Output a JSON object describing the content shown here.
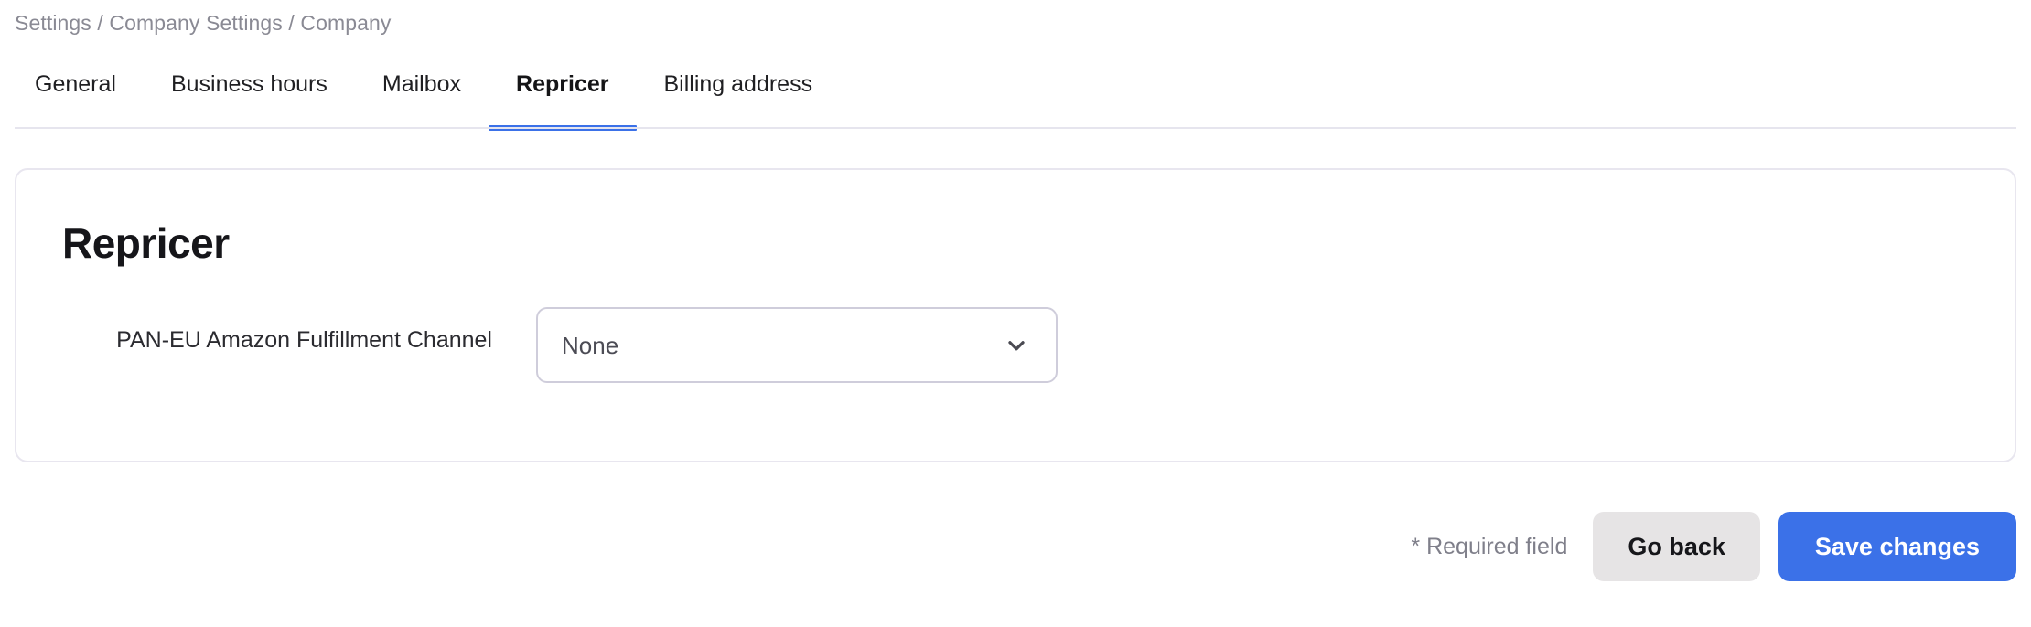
{
  "breadcrumb": {
    "text": "Settings / Company Settings / Company"
  },
  "tabs": [
    {
      "label": "General",
      "active": false
    },
    {
      "label": "Business hours",
      "active": false
    },
    {
      "label": "Mailbox",
      "active": false
    },
    {
      "label": "Repricer",
      "active": true
    },
    {
      "label": "Billing address",
      "active": false
    }
  ],
  "card": {
    "title": "Repricer",
    "field": {
      "label": "PAN-EU Amazon Fulfillment Channel",
      "selected_value": "None",
      "chevron_icon": "chevron-down-icon"
    }
  },
  "footer": {
    "required_note": "* Required field",
    "go_back_label": "Go back",
    "save_label": "Save changes"
  },
  "colors": {
    "accent_blue": "#3b71e8",
    "secondary_button_bg": "#e6e4e5",
    "card_border": "#e8e6ef",
    "divider": "#e6e5ee",
    "breadcrumb_text": "#8a8a94"
  }
}
